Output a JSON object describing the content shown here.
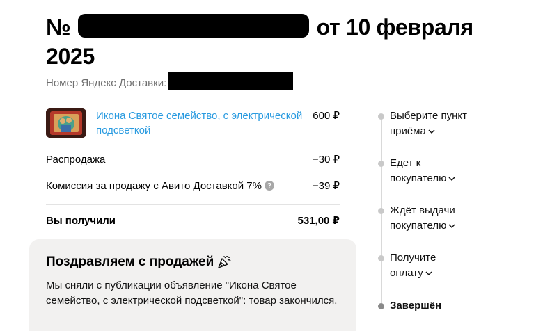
{
  "header": {
    "title_prefix": "№",
    "title_suffix": "от 10 февраля 2025",
    "subtitle_label": "Номер Яндекс Доставки:"
  },
  "order": {
    "item": {
      "name": "Икона Святое семейство, с электрической подсветкой",
      "price": "600 ₽"
    },
    "lines": [
      {
        "label": "Распродажа",
        "amount": "−30 ₽"
      },
      {
        "label": "Комиссия за продажу с Авито Доставкой 7%",
        "amount": "−39 ₽",
        "help": "?"
      }
    ],
    "total": {
      "label": "Вы получили",
      "amount": "531,00 ₽"
    }
  },
  "congrats": {
    "title": "Поздравляем с продажей",
    "text": "Мы сняли с публикации объявление \"Икона Святое семейство, с электрической подсветкой\": товар закончился."
  },
  "timeline": {
    "steps": [
      {
        "line1": "Выберите пункт",
        "line2": "приёма"
      },
      {
        "line1": "Едет к",
        "line2": "покупателю"
      },
      {
        "line1": "Ждёт выдачи",
        "line2": "покупателю"
      },
      {
        "line1": "Получите",
        "line2": "оплату"
      }
    ],
    "final": "Завершён"
  },
  "colors": {
    "link": "#2a9be0",
    "card_bg": "#f2f1f0",
    "muted": "#6f6f6f"
  }
}
